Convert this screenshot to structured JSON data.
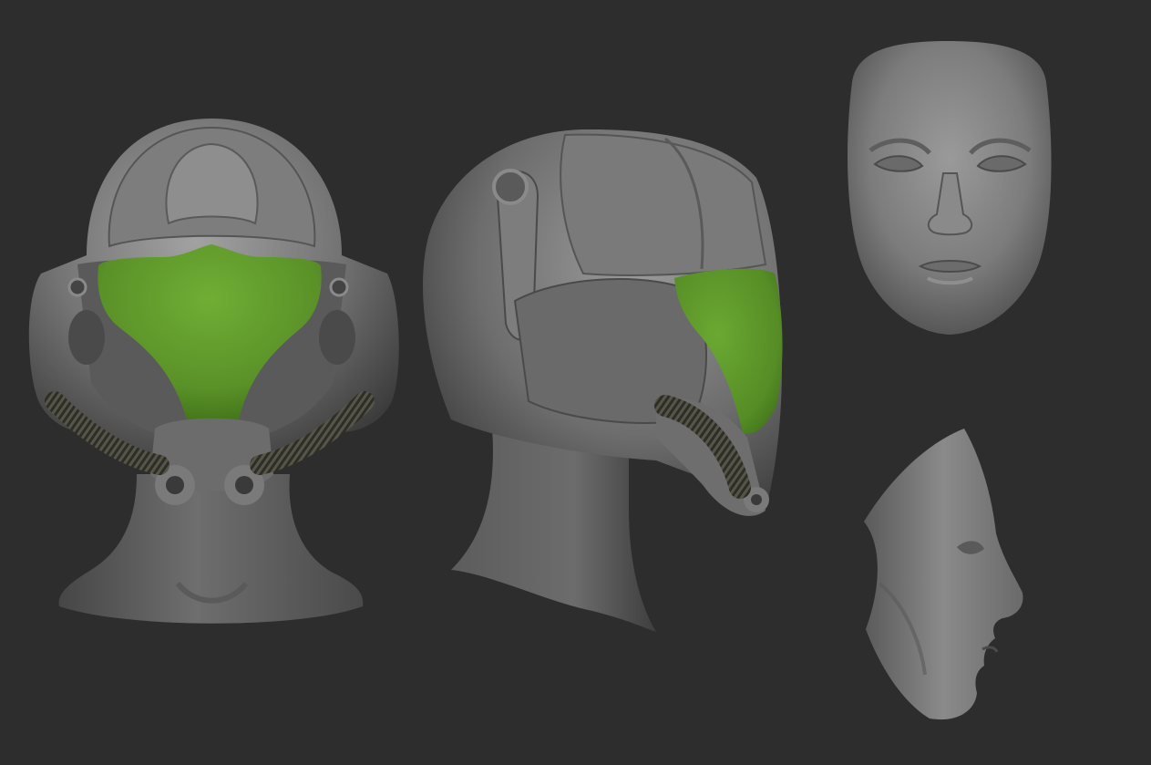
{
  "scene": {
    "background": "#2d2d2d",
    "clay_color": "#777777",
    "clay_dark": "#3e3e3e",
    "clay_light": "#a6a6a6",
    "visor_color": "#5f9a2c",
    "visor_dark": "#3d6b16",
    "hose_color": "#3a3a2f",
    "models": [
      {
        "name": "helmet",
        "view": "front",
        "has_visor": true,
        "has_hoses": true
      },
      {
        "name": "helmet",
        "view": "three-quarter",
        "has_visor": true,
        "has_hoses": true
      },
      {
        "name": "face",
        "view": "front",
        "has_visor": false,
        "has_hoses": false
      },
      {
        "name": "face",
        "view": "side",
        "has_visor": false,
        "has_hoses": false
      }
    ]
  }
}
